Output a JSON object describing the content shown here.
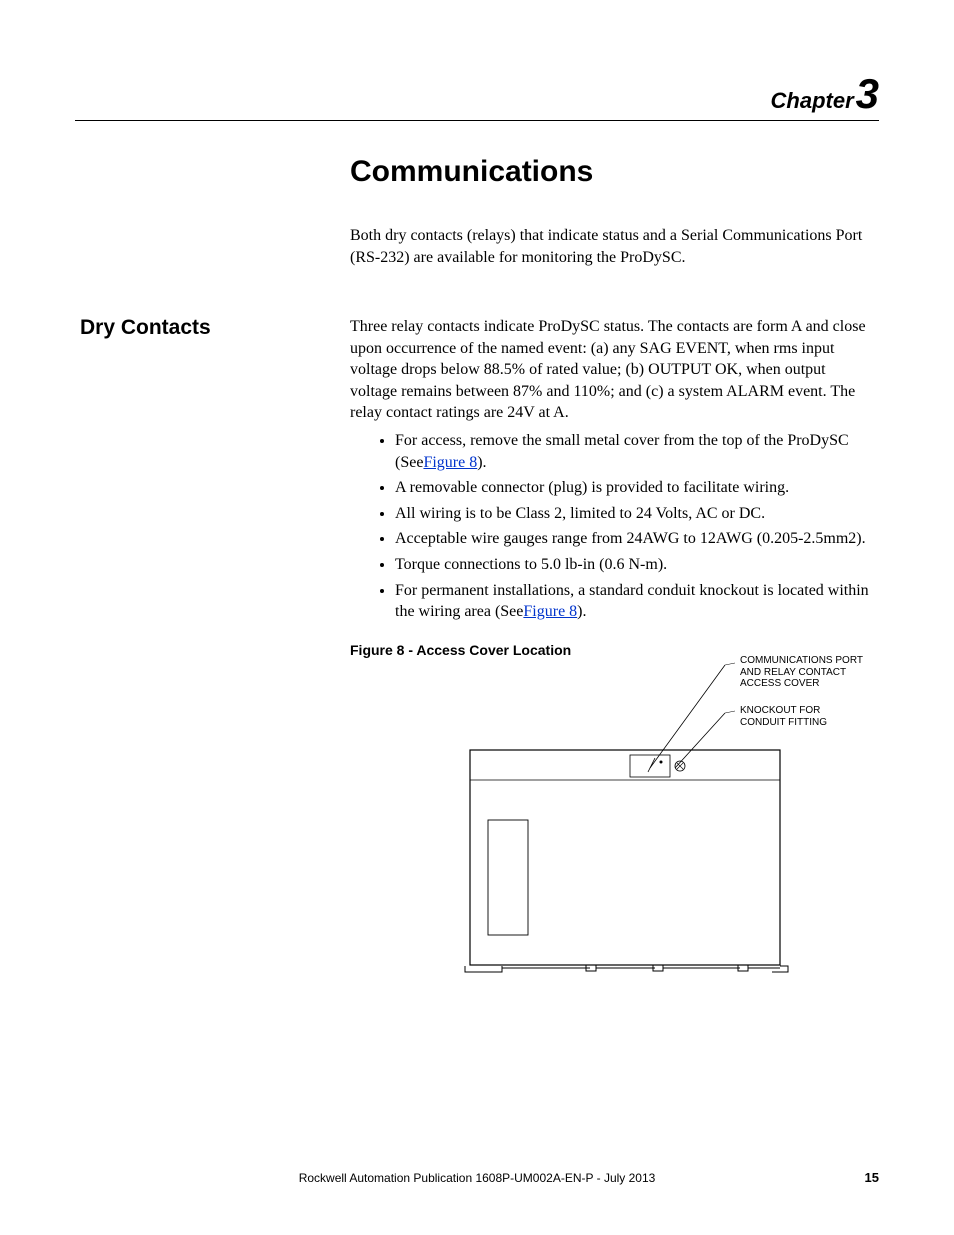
{
  "chapter": {
    "label": "Chapter",
    "number": "3"
  },
  "title": "Communications",
  "intro": "Both dry contacts (relays) that indicate status and a Serial Communications Port (RS-232) are available for monitoring the ProDySC.",
  "section": {
    "heading": "Dry Contacts",
    "para": "Three relay contacts indicate ProDySC status. The contacts are form A and close upon occurrence of the named event: (a) any SAG EVENT, when rms input voltage drops below 88.5% of rated value; (b) OUTPUT OK, when output voltage remains between 87% and 110%; and (c) a system ALARM event. The relay contact ratings are 24V at A.",
    "bullets": [
      {
        "pre": "For access, remove the small metal cover from the top of the ProDySC (See",
        "link": "Figure 8",
        "post": ")."
      },
      {
        "pre": "A removable connector (plug) is provided to facilitate wiring.",
        "link": "",
        "post": ""
      },
      {
        "pre": "All wiring is to be Class 2, limited to 24 Volts, AC or DC.",
        "link": "",
        "post": ""
      },
      {
        "pre": "Acceptable wire gauges range from 24AWG to 12AWG (0.205-2.5mm2).",
        "link": "",
        "post": ""
      },
      {
        "pre": "Torque connections to 5.0 lb-in (0.6 N-m).",
        "link": "",
        "post": ""
      },
      {
        "pre": "For permanent installations, a standard conduit knockout is located within the wiring area (See",
        "link": "Figure 8",
        "post": ")."
      }
    ],
    "figure_caption": "Figure 8 - Access Cover Location"
  },
  "diagram": {
    "callout1_l1": "COMMUNICATIONS PORT",
    "callout1_l2": "AND RELAY CONTACT",
    "callout1_l3": "ACCESS COVER",
    "callout2_l1": "KNOCKOUT FOR",
    "callout2_l2": "CONDUIT FITTING"
  },
  "footer": "Rockwell Automation Publication 1608P-UM002A-EN-P - July 2013",
  "page_number": "15"
}
